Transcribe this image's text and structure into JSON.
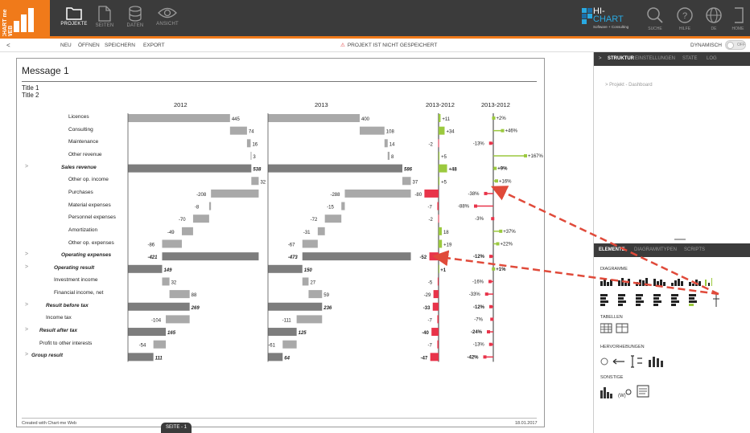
{
  "app": {
    "logo_text": "CHART me WEB",
    "nav": [
      {
        "label": "PROJEKTE",
        "icon": "folder-icon",
        "active": true
      },
      {
        "label": "SEITEN",
        "icon": "page-icon",
        "active": false
      },
      {
        "label": "DATEN",
        "icon": "database-icon",
        "active": false
      },
      {
        "label": "ANSICHT",
        "icon": "eye-icon",
        "active": false
      }
    ],
    "brand": {
      "line1": "HI-",
      "line2": "CHART",
      "tag": "Software + Consulting"
    },
    "right_nav": [
      {
        "label": "SUCHE",
        "icon": "search-icon"
      },
      {
        "label": "HILFE",
        "icon": "help-icon"
      },
      {
        "label": "DE",
        "icon": "globe-icon"
      },
      {
        "label": "HOME",
        "icon": "home-icon"
      }
    ]
  },
  "menu": {
    "back": "<",
    "items": [
      "NEU",
      "ÖFFNEN",
      "SPEICHERN",
      "EXPORT"
    ],
    "warning": "PROJEKT IST NICHT GESPEICHERT",
    "dynamic_label": "DYNAMISCH",
    "toggle_label": "OFF"
  },
  "canvas": {
    "message": "Message 1",
    "title1": "Title 1",
    "title2": "Title 2",
    "footer_left": "Created with Chart-me Web",
    "footer_right": "18.01.2017",
    "page_tab": "SEITE - 1"
  },
  "chart_data": {
    "type": "bar",
    "columns": [
      "2012",
      "2013",
      "2013-2012",
      "2013-2012"
    ],
    "rows": [
      {
        "label": "Licences",
        "bold": false,
        "v2012": 445,
        "v2013": 400,
        "abs": "+11",
        "pct": "+2%"
      },
      {
        "label": "Consulting",
        "bold": false,
        "v2012": 74,
        "v2013": 108,
        "abs": "+34",
        "pct": "+46%"
      },
      {
        "label": "Maintenance",
        "bold": false,
        "v2012": 16,
        "v2013": 14,
        "abs": "-2",
        "pct": "-13%"
      },
      {
        "label": "Other revenue",
        "bold": false,
        "v2012": 3,
        "v2013": 8,
        "abs": "+5",
        "pct": "+167%"
      },
      {
        "label": "Sales revenue",
        "bold": true,
        "v2012": 538,
        "v2013": 586,
        "abs": "+48",
        "pct": "+9%"
      },
      {
        "label": "Other op. income",
        "bold": false,
        "v2012": 32,
        "v2013": 37,
        "abs": "+5",
        "pct": "+16%"
      },
      {
        "label": "Purchases",
        "bold": false,
        "v2012": -208,
        "v2013": -288,
        "abs": "-80",
        "pct": "-38%"
      },
      {
        "label": "Material expenses",
        "bold": false,
        "v2012": -8,
        "v2013": -15,
        "abs": "-7",
        "pct": "-88%"
      },
      {
        "label": "Personnel expenses",
        "bold": false,
        "v2012": -70,
        "v2013": -72,
        "abs": "-2",
        "pct": "-3%"
      },
      {
        "label": "Amortization",
        "bold": false,
        "v2012": -49,
        "v2013": -31,
        "abs": "18",
        "pct": "+37%"
      },
      {
        "label": "Other op. expenses",
        "bold": false,
        "v2012": -86,
        "v2013": -67,
        "abs": "+19",
        "pct": "+22%"
      },
      {
        "label": "Operating expenses",
        "bold": true,
        "v2012": -421,
        "v2013": -473,
        "abs": "-52",
        "pct": "-12%"
      },
      {
        "label": "Operating result",
        "bold": true,
        "v2012": 149,
        "v2013": 150,
        "abs": "+1",
        "pct": "+1%"
      },
      {
        "label": "Investment income",
        "bold": false,
        "v2012": 32,
        "v2013": 27,
        "abs": "-5",
        "pct": "-16%"
      },
      {
        "label": "Financial income, net",
        "bold": false,
        "v2012": 88,
        "v2013": 59,
        "abs": "-29",
        "pct": "-33%"
      },
      {
        "label": "Result before tax",
        "bold": true,
        "v2012": 269,
        "v2013": 236,
        "abs": "-33",
        "pct": "-12%"
      },
      {
        "label": "Income tax",
        "bold": false,
        "v2012": -104,
        "v2013": -111,
        "abs": "-7",
        "pct": "-7%"
      },
      {
        "label": "Result after tax",
        "bold": true,
        "v2012": 165,
        "v2013": 125,
        "abs": "-40",
        "pct": "-24%"
      },
      {
        "label": "Profit to other interests",
        "bold": false,
        "v2012": -54,
        "v2013": -61,
        "abs": "-7",
        "pct": "-13%"
      },
      {
        "label": "Group result",
        "bold": true,
        "v2012": 111,
        "v2013": 64,
        "abs": "-47",
        "pct": "-42%"
      }
    ],
    "colors": {
      "bar": "#a9a9a9",
      "total": "#7d7d7d",
      "positive": "#9bc93e",
      "negative": "#e8344a",
      "arrow": "#e04a3a"
    }
  },
  "panel": {
    "tabs": [
      "STRUKTUR",
      "EINSTELLUNGEN",
      "STATE",
      "LOG"
    ],
    "tree_item": "Projekt - Dashboard",
    "elem_tabs": [
      "ELEMENTE",
      "DIAGRAMMTYPEN",
      "SCRIPTS"
    ],
    "sections": [
      "DIAGRAMME",
      "TABELLEN",
      "HERVORHEBUNGEN",
      "SONSTIGE"
    ]
  }
}
